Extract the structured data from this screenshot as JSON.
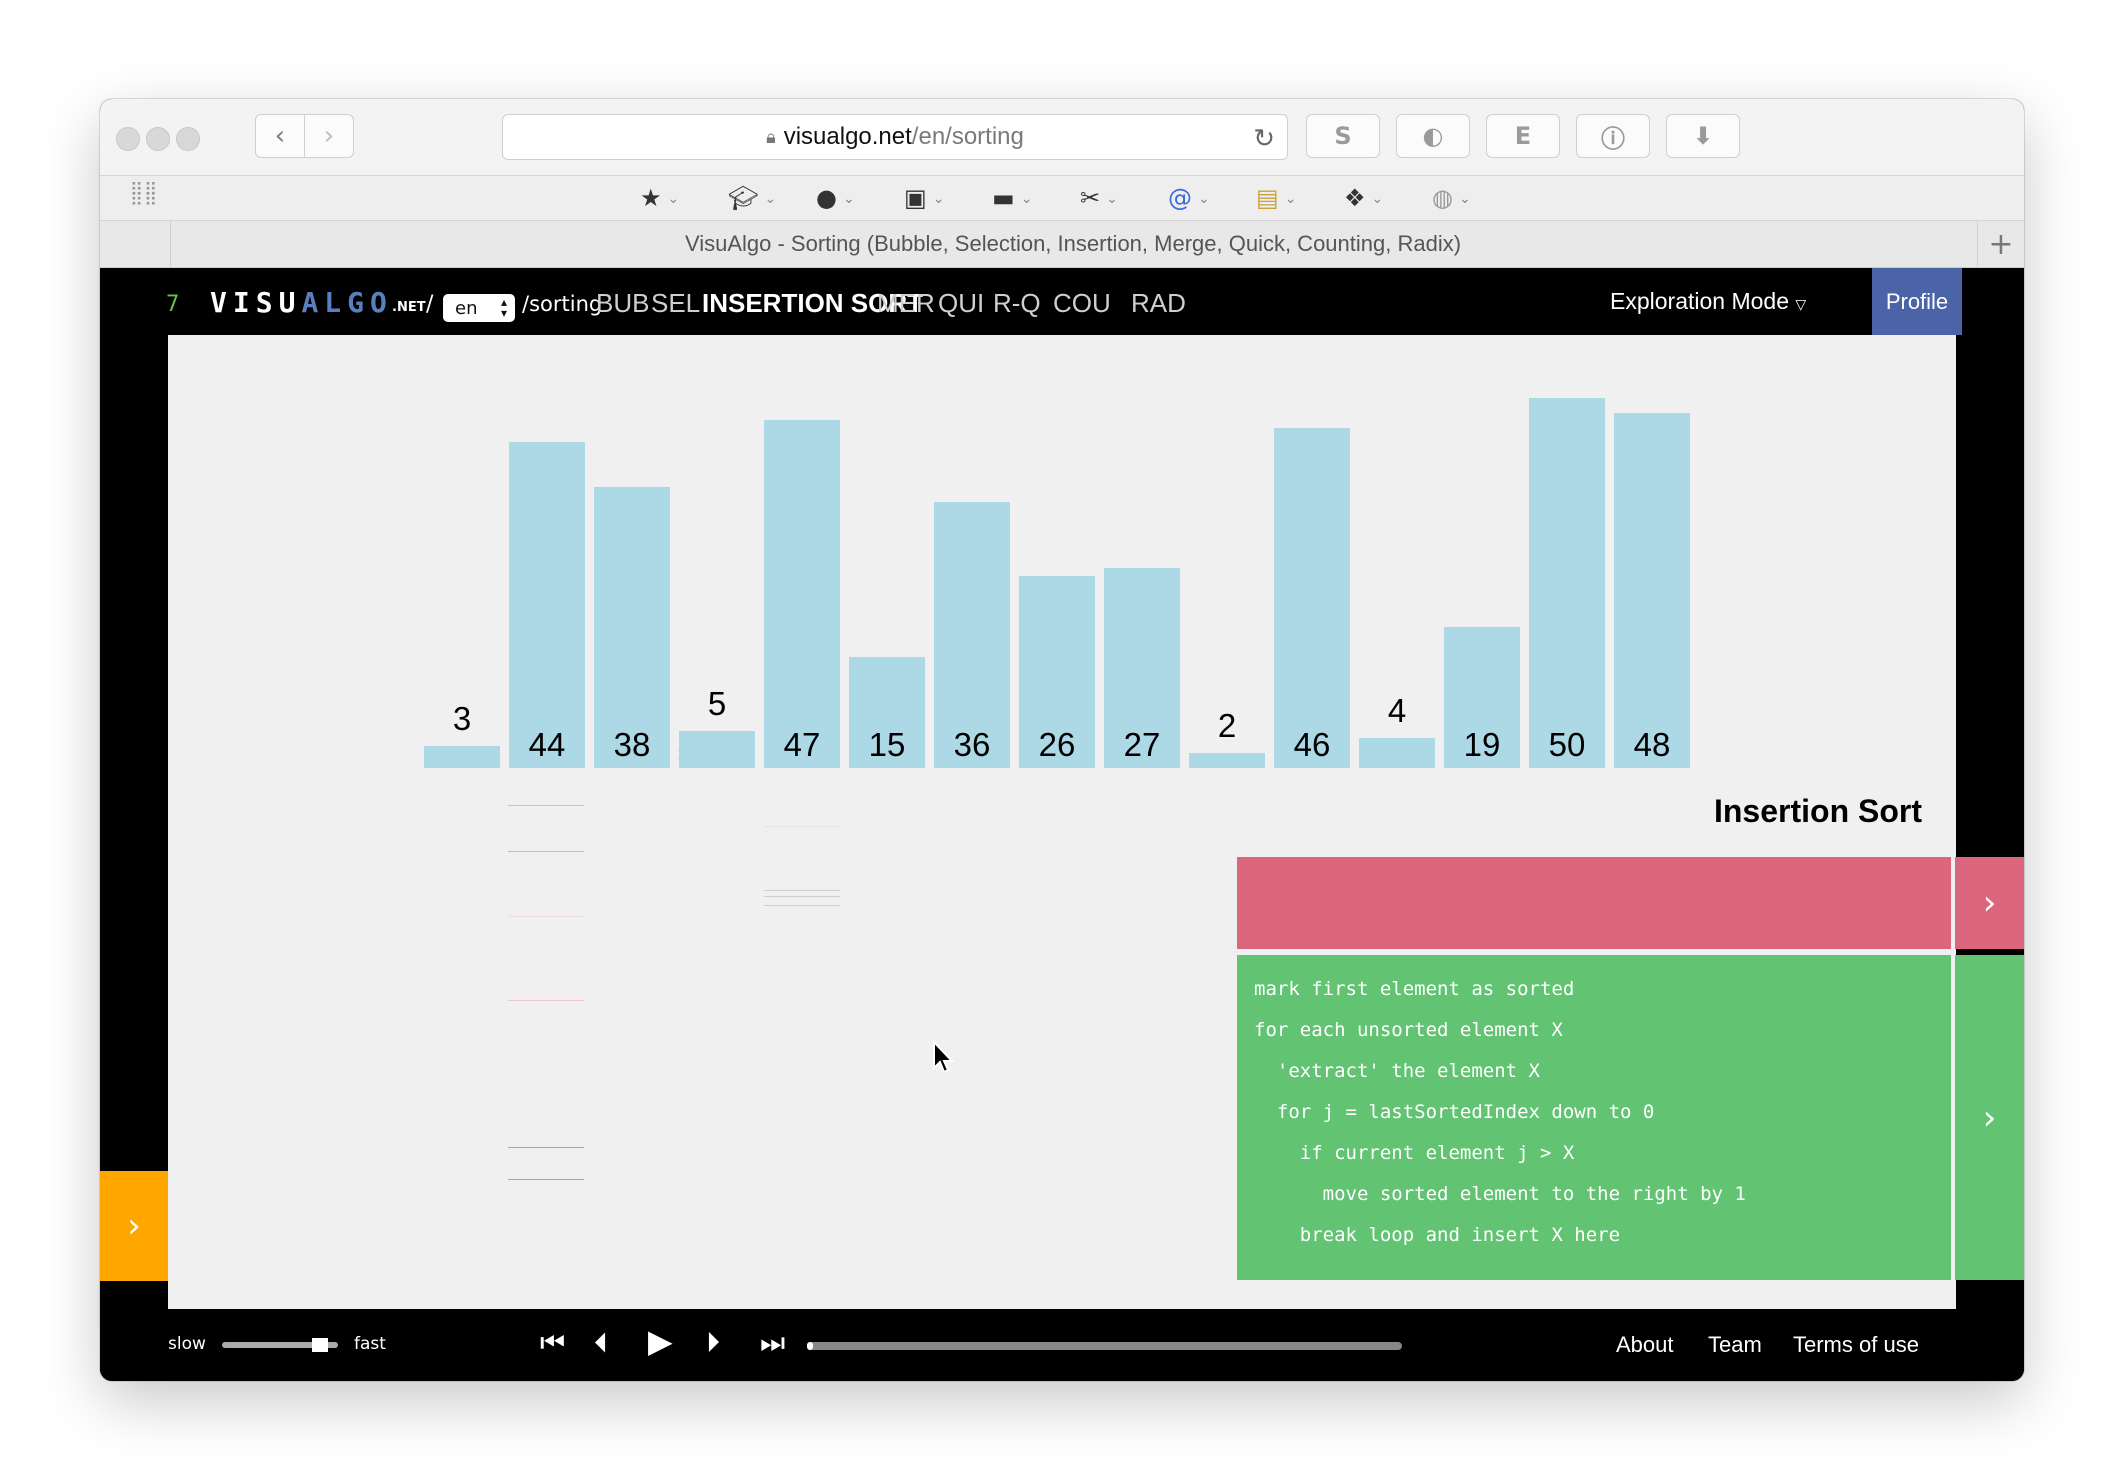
{
  "browser": {
    "url_host": "visualgo.net",
    "url_path": "/en/sorting",
    "tab_title": "VisuAlgo - Sorting (Bubble, Selection, Insertion, Merge, Quick, Counting, Radix)",
    "extensions": [
      "S",
      "◐",
      "E",
      "ⓘ",
      "⬇"
    ],
    "bookmark_icons": [
      "star-icon",
      "graduation-cap-icon",
      "crystal-ball-icon",
      "briefcase-icon",
      "laptop-icon",
      "tools-icon",
      "spiral-icon",
      "lock-bag-icon",
      "paw-icon",
      "plate-icon"
    ]
  },
  "nav": {
    "version": "7",
    "logo_white": "VISU",
    "logo_blue": "ALGO",
    "logo_net": ".NET",
    "slash": "/",
    "language": "en",
    "path": "/sorting",
    "links": [
      "BUB",
      "SEL",
      "INSERTION SORT",
      "MER",
      "QUI",
      "R-Q",
      "COU",
      "RAD"
    ],
    "active_index": 2,
    "mode": "Exploration Mode",
    "profile": "Profile"
  },
  "chart_data": {
    "type": "bar",
    "values": [
      3,
      44,
      38,
      5,
      47,
      15,
      36,
      26,
      27,
      2,
      46,
      4,
      19,
      50,
      48
    ],
    "bar_color": "#add8e6"
  },
  "algorithm": {
    "title": "Insertion Sort",
    "status_text": "",
    "code": [
      "mark first element as sorted",
      "for each unsorted element X",
      "  'extract' the element X",
      "  for j = lastSortedIndex down to 0",
      "    if current element j > X",
      "      move sorted element to the right by 1",
      "    break loop and insert X here"
    ]
  },
  "controls": {
    "slow": "slow",
    "fast": "fast",
    "speed_level": 0.9,
    "progress": 0.01
  },
  "footer": {
    "about": "About",
    "team": "Team",
    "terms": "Terms of use"
  },
  "colors": {
    "status": "#dc667e",
    "code": "#62c372",
    "side_button": "#ffa500",
    "profile": "#4b64a8"
  }
}
